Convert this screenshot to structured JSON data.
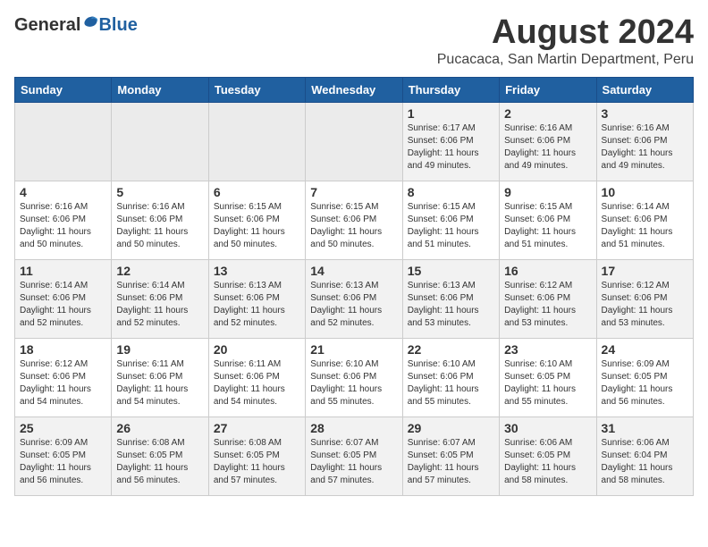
{
  "header": {
    "logo_general": "General",
    "logo_blue": "Blue",
    "title": "August 2024",
    "subtitle": "Pucacaca, San Martin Department, Peru"
  },
  "calendar": {
    "days_of_week": [
      "Sunday",
      "Monday",
      "Tuesday",
      "Wednesday",
      "Thursday",
      "Friday",
      "Saturday"
    ],
    "weeks": [
      [
        {
          "day": "",
          "info": ""
        },
        {
          "day": "",
          "info": ""
        },
        {
          "day": "",
          "info": ""
        },
        {
          "day": "",
          "info": ""
        },
        {
          "day": "1",
          "info": "Sunrise: 6:17 AM\nSunset: 6:06 PM\nDaylight: 11 hours\nand 49 minutes."
        },
        {
          "day": "2",
          "info": "Sunrise: 6:16 AM\nSunset: 6:06 PM\nDaylight: 11 hours\nand 49 minutes."
        },
        {
          "day": "3",
          "info": "Sunrise: 6:16 AM\nSunset: 6:06 PM\nDaylight: 11 hours\nand 49 minutes."
        }
      ],
      [
        {
          "day": "4",
          "info": "Sunrise: 6:16 AM\nSunset: 6:06 PM\nDaylight: 11 hours\nand 50 minutes."
        },
        {
          "day": "5",
          "info": "Sunrise: 6:16 AM\nSunset: 6:06 PM\nDaylight: 11 hours\nand 50 minutes."
        },
        {
          "day": "6",
          "info": "Sunrise: 6:15 AM\nSunset: 6:06 PM\nDaylight: 11 hours\nand 50 minutes."
        },
        {
          "day": "7",
          "info": "Sunrise: 6:15 AM\nSunset: 6:06 PM\nDaylight: 11 hours\nand 50 minutes."
        },
        {
          "day": "8",
          "info": "Sunrise: 6:15 AM\nSunset: 6:06 PM\nDaylight: 11 hours\nand 51 minutes."
        },
        {
          "day": "9",
          "info": "Sunrise: 6:15 AM\nSunset: 6:06 PM\nDaylight: 11 hours\nand 51 minutes."
        },
        {
          "day": "10",
          "info": "Sunrise: 6:14 AM\nSunset: 6:06 PM\nDaylight: 11 hours\nand 51 minutes."
        }
      ],
      [
        {
          "day": "11",
          "info": "Sunrise: 6:14 AM\nSunset: 6:06 PM\nDaylight: 11 hours\nand 52 minutes."
        },
        {
          "day": "12",
          "info": "Sunrise: 6:14 AM\nSunset: 6:06 PM\nDaylight: 11 hours\nand 52 minutes."
        },
        {
          "day": "13",
          "info": "Sunrise: 6:13 AM\nSunset: 6:06 PM\nDaylight: 11 hours\nand 52 minutes."
        },
        {
          "day": "14",
          "info": "Sunrise: 6:13 AM\nSunset: 6:06 PM\nDaylight: 11 hours\nand 52 minutes."
        },
        {
          "day": "15",
          "info": "Sunrise: 6:13 AM\nSunset: 6:06 PM\nDaylight: 11 hours\nand 53 minutes."
        },
        {
          "day": "16",
          "info": "Sunrise: 6:12 AM\nSunset: 6:06 PM\nDaylight: 11 hours\nand 53 minutes."
        },
        {
          "day": "17",
          "info": "Sunrise: 6:12 AM\nSunset: 6:06 PM\nDaylight: 11 hours\nand 53 minutes."
        }
      ],
      [
        {
          "day": "18",
          "info": "Sunrise: 6:12 AM\nSunset: 6:06 PM\nDaylight: 11 hours\nand 54 minutes."
        },
        {
          "day": "19",
          "info": "Sunrise: 6:11 AM\nSunset: 6:06 PM\nDaylight: 11 hours\nand 54 minutes."
        },
        {
          "day": "20",
          "info": "Sunrise: 6:11 AM\nSunset: 6:06 PM\nDaylight: 11 hours\nand 54 minutes."
        },
        {
          "day": "21",
          "info": "Sunrise: 6:10 AM\nSunset: 6:06 PM\nDaylight: 11 hours\nand 55 minutes."
        },
        {
          "day": "22",
          "info": "Sunrise: 6:10 AM\nSunset: 6:06 PM\nDaylight: 11 hours\nand 55 minutes."
        },
        {
          "day": "23",
          "info": "Sunrise: 6:10 AM\nSunset: 6:05 PM\nDaylight: 11 hours\nand 55 minutes."
        },
        {
          "day": "24",
          "info": "Sunrise: 6:09 AM\nSunset: 6:05 PM\nDaylight: 11 hours\nand 56 minutes."
        }
      ],
      [
        {
          "day": "25",
          "info": "Sunrise: 6:09 AM\nSunset: 6:05 PM\nDaylight: 11 hours\nand 56 minutes."
        },
        {
          "day": "26",
          "info": "Sunrise: 6:08 AM\nSunset: 6:05 PM\nDaylight: 11 hours\nand 56 minutes."
        },
        {
          "day": "27",
          "info": "Sunrise: 6:08 AM\nSunset: 6:05 PM\nDaylight: 11 hours\nand 57 minutes."
        },
        {
          "day": "28",
          "info": "Sunrise: 6:07 AM\nSunset: 6:05 PM\nDaylight: 11 hours\nand 57 minutes."
        },
        {
          "day": "29",
          "info": "Sunrise: 6:07 AM\nSunset: 6:05 PM\nDaylight: 11 hours\nand 57 minutes."
        },
        {
          "day": "30",
          "info": "Sunrise: 6:06 AM\nSunset: 6:05 PM\nDaylight: 11 hours\nand 58 minutes."
        },
        {
          "day": "31",
          "info": "Sunrise: 6:06 AM\nSunset: 6:04 PM\nDaylight: 11 hours\nand 58 minutes."
        }
      ]
    ]
  }
}
